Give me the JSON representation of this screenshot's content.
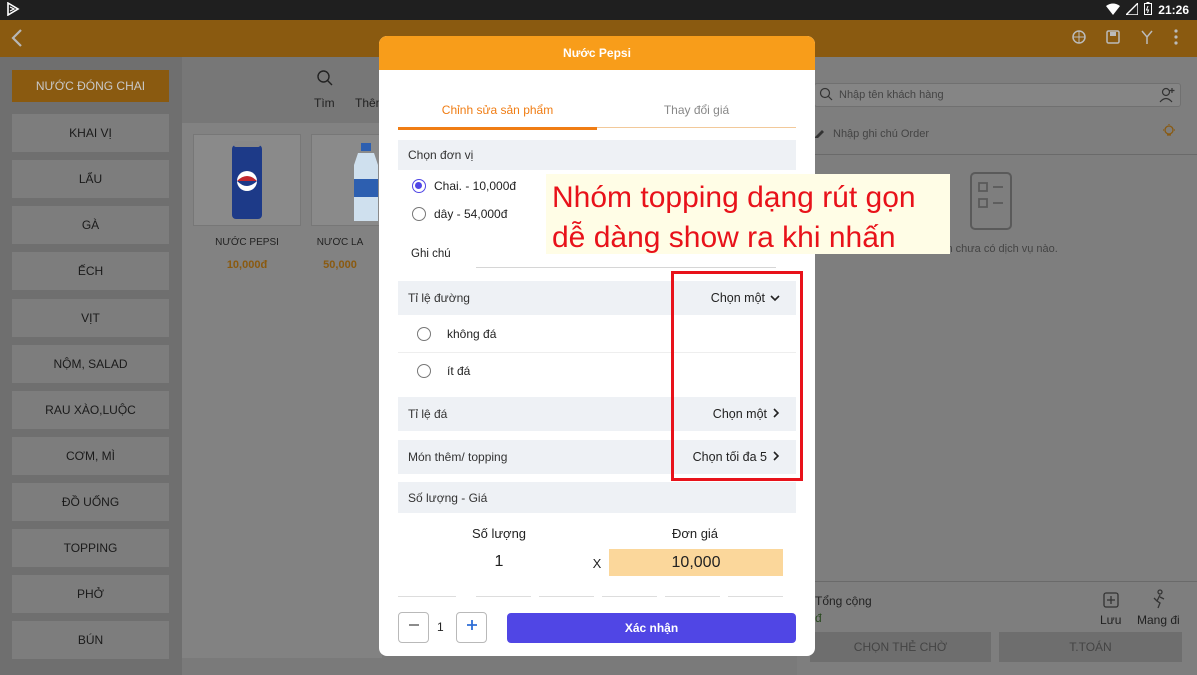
{
  "status_bar": {
    "time": "21:26"
  },
  "categories": {
    "header": "NƯỚC ĐÓNG CHAI",
    "items": [
      "KHAI VỊ",
      "LẨU",
      "GÀ",
      "ẾCH",
      "VỊT",
      "NỘM, SALAD",
      "RAU XÀO,LUỘC",
      "CƠM, MÌ",
      "ĐỒ UỐNG",
      "TOPPING",
      "PHỞ",
      "BÚN"
    ]
  },
  "search": {
    "search_label": "Tìm",
    "add_label": "Thêm"
  },
  "products": [
    {
      "name": "NƯỚC PEPSI",
      "price": "10,000đ"
    },
    {
      "name": "NƯỚC LA",
      "price": "50,000"
    }
  ],
  "right_panel": {
    "customer_placeholder": "Nhập tên khách hàng",
    "order_note_placeholder": "Nhập ghi chú Order",
    "empty_text": "Hiện chưa có dịch vụ nào.",
    "total_label": "Tổng cộng",
    "total_value": "đ",
    "save_label": "Lưu",
    "takeaway_label": "Mang đi",
    "wait_card_button": "CHỌN THẺ CHỜ",
    "pay_button": "T.TOÁN"
  },
  "modal": {
    "title": "Nước Pepsi",
    "tabs": [
      "Chỉnh sửa sản phẩm",
      "Thay đổi giá"
    ],
    "unit_section": "Chọn đơn vị",
    "units": [
      {
        "label": "Chai. - 10,000đ",
        "selected": true
      },
      {
        "label": "dây - 54,000đ",
        "selected": false
      }
    ],
    "note_label": "Ghi chú",
    "groups": [
      {
        "label": "Tỉ lệ đường",
        "action": "Chọn một",
        "expanded": true,
        "options": [
          "không đá",
          "ít đá"
        ]
      },
      {
        "label": "Tỉ lệ đá",
        "action": "Chọn một",
        "expanded": false
      },
      {
        "label": "Món thêm/ topping",
        "action": "Chọn tối đa 5",
        "expanded": false
      }
    ],
    "qty_price_section": "Số lượng - Giá",
    "qty_label": "Số lượng",
    "price_label": "Đơn giá",
    "qty_value": "1",
    "times_symbol": "X",
    "price_value": "10,000",
    "stepper_value": "1",
    "confirm_label": "Xác nhận"
  },
  "annotation": {
    "line1": "Nhóm topping dạng rút gọn",
    "line2": "dễ dàng show ra khi nhấn",
    "color": "#e8121a"
  },
  "colors": {
    "accent_orange": "#f89d1a",
    "primary_purple": "#5046e5",
    "price_highlight": "#fbd79b"
  }
}
